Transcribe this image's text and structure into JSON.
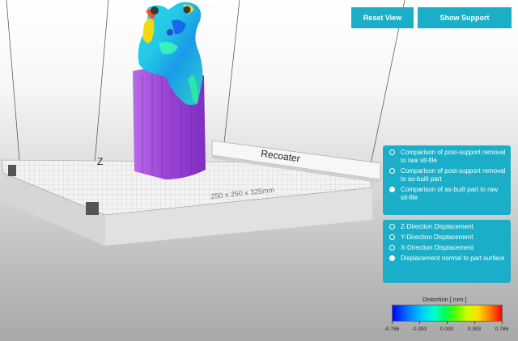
{
  "toolbar": {
    "reset_label": "Reset View",
    "support_label": "Show Support"
  },
  "scene": {
    "recoater_label": "Recoater",
    "build_plate_label": "250 x 250 x 325mm",
    "axis_label": "Z"
  },
  "comparison_options": [
    {
      "label": "Comparison of post-support removal to raw stl-file",
      "selected": false
    },
    {
      "label": "Comparison of post-support removal to as-built part",
      "selected": false
    },
    {
      "label": "Comparison of as-built part to raw stl-file",
      "selected": true
    }
  ],
  "displacement_options": [
    {
      "label": "Z-Direction Displacement",
      "selected": false
    },
    {
      "label": "Y-Direction Displacement",
      "selected": false
    },
    {
      "label": "X-Direction Displacement",
      "selected": false
    },
    {
      "label": "Displacement normal to part surface",
      "selected": true
    }
  ],
  "legend": {
    "title": "Distortion [ mm ]",
    "ticks": [
      "-0.786",
      "-0.393",
      "0.000",
      "0.393",
      "0.786"
    ]
  },
  "colors": {
    "accent": "#1aaec8",
    "support": "#a050d8",
    "plate": "#ececec"
  }
}
